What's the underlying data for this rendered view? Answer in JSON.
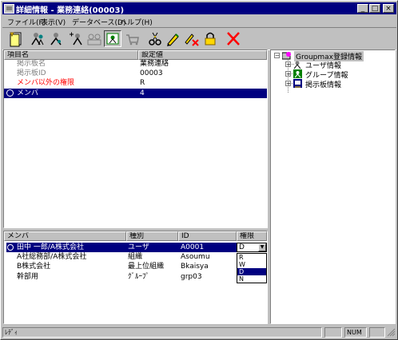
{
  "window": {
    "title": "詳細情報 - 業務連絡(00003)"
  },
  "titlebar_buttons": {
    "minimize": "_",
    "maximize": "□",
    "close": "×"
  },
  "menu": [
    {
      "label": "ファイル(F)"
    },
    {
      "label": "表示(V)"
    },
    {
      "label": "データベース(D)"
    },
    {
      "label": "ヘルプ(H)"
    }
  ],
  "toolbar": {
    "icons": [
      "new-entry-icon",
      "user-group-icon",
      "user-icon",
      "add-user-icon",
      "users-icon",
      "group-select-icon",
      "basket-icon",
      "cut-icon",
      "edit-icon",
      "delete-icon",
      "lock-icon",
      "cancel-icon"
    ]
  },
  "properties": {
    "headers": {
      "name": "項目名",
      "value": "設定値"
    },
    "rows": [
      {
        "name": "掲示板名",
        "value": "業務連絡",
        "color": "#808080"
      },
      {
        "name": "掲示板ID",
        "value": "00003",
        "color": "#808080"
      },
      {
        "name": "メンバ以外の権限",
        "value": "R",
        "color": "#ff0000"
      },
      {
        "name": "メンバ",
        "value": "4",
        "selected": true
      }
    ]
  },
  "members": {
    "headers": {
      "member": "メンバ",
      "type": "種別",
      "id": "ID",
      "perm": "権限"
    },
    "rows": [
      {
        "member": "田中 一郎/A株式会社",
        "type": "ユーザ",
        "id": "A0001",
        "perm": "D",
        "selected": true
      },
      {
        "member": "A社総務部/A株式会社",
        "type": "組織",
        "id": "Asoumu",
        "perm": "R"
      },
      {
        "member": "B株式会社",
        "type": "最上位組織",
        "id": "Bkaisya",
        "perm": "W"
      },
      {
        "member": "幹部用",
        "type": "ｸﾞﾙｰﾌﾟ",
        "id": "grp03",
        "perm": "D"
      }
    ],
    "perm_dropdown": {
      "value": "D",
      "options": [
        "R",
        "W",
        "D",
        "N"
      ],
      "selected_index": 2
    }
  },
  "tree": {
    "root": "Groupmax登録情報",
    "children": [
      "ユーザ情報",
      "グループ情報",
      "掲示板情報"
    ]
  },
  "status": {
    "text": "ﾚﾃﾞｨ",
    "num": "NUM"
  },
  "colors": {
    "titlebar": "#000080",
    "selection": "#000080",
    "face": "#c0c0c0"
  }
}
